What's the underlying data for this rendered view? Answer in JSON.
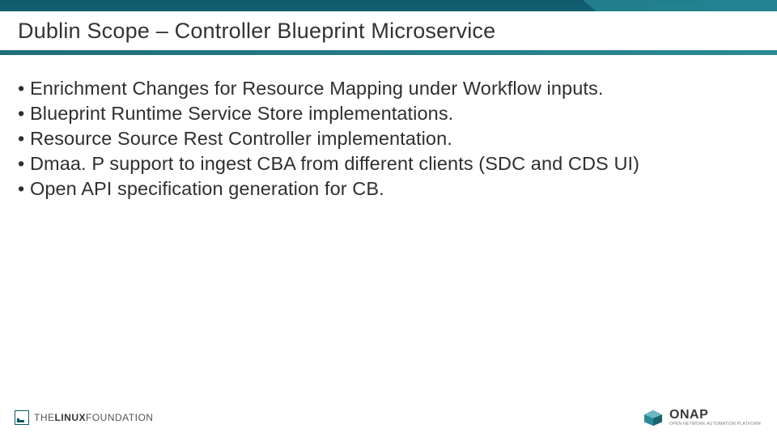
{
  "header": {
    "title": "Dublin Scope – Controller Blueprint Microservice"
  },
  "bullets": [
    "Enrichment Changes for Resource Mapping under Workflow inputs.",
    "Blueprint Runtime Service Store implementations.",
    "Resource Source Rest Controller implementation.",
    "Dmaa. P support to ingest CBA from different clients (SDC and CDS UI)",
    "Open API specification generation for CB."
  ],
  "footer": {
    "linux_foundation": {
      "the": "THE",
      "linux": "LINUX",
      "foundation": "FOUNDATION"
    },
    "onap": {
      "name": "ONAP",
      "tagline": "OPEN NETWORK AUTOMATION PLATFORM"
    }
  }
}
